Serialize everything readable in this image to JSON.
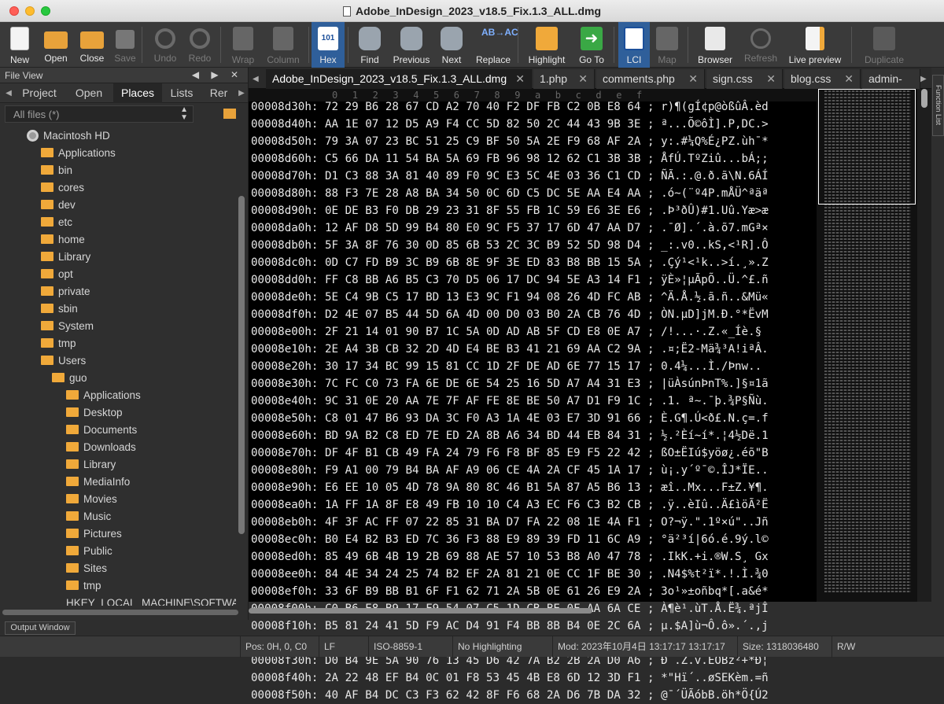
{
  "window": {
    "title": "Adobe_InDesign_2023_v18.5_Fix.1.3_ALL.dmg"
  },
  "toolbar": [
    {
      "id": "new",
      "label": "New",
      "icon": "new-file-icon",
      "enabled": true
    },
    {
      "id": "open",
      "label": "Open",
      "icon": "open-folder-icon",
      "enabled": true
    },
    {
      "id": "close",
      "label": "Close",
      "icon": "close-folder-icon",
      "enabled": true
    },
    {
      "id": "save",
      "label": "Save",
      "icon": "save-icon",
      "enabled": false
    },
    {
      "id": "undo",
      "label": "Undo",
      "icon": "undo-icon",
      "enabled": false
    },
    {
      "id": "redo",
      "label": "Redo",
      "icon": "redo-icon",
      "enabled": false
    },
    {
      "id": "wrap",
      "label": "Wrap",
      "icon": "wrap-icon",
      "enabled": false
    },
    {
      "id": "column",
      "label": "Column",
      "icon": "column-icon",
      "enabled": false
    },
    {
      "id": "hex",
      "label": "Hex",
      "icon": "hex-icon",
      "enabled": true,
      "active": true,
      "icon_text": "101"
    },
    {
      "id": "find",
      "label": "Find",
      "icon": "binoculars-icon",
      "enabled": true
    },
    {
      "id": "previous",
      "label": "Previous",
      "icon": "find-previous-icon",
      "enabled": true
    },
    {
      "id": "next",
      "label": "Next",
      "icon": "find-next-icon",
      "enabled": true
    },
    {
      "id": "replace",
      "label": "Replace",
      "icon": "replace-icon",
      "enabled": true,
      "icon_text": "AB→AC"
    },
    {
      "id": "highlight",
      "label": "Highlight",
      "icon": "highlight-icon",
      "enabled": true
    },
    {
      "id": "goto",
      "label": "Go To",
      "icon": "goto-arrow-icon",
      "enabled": true
    },
    {
      "id": "lci",
      "label": "LCI",
      "icon": "lci-icon",
      "enabled": true,
      "active": true
    },
    {
      "id": "map",
      "label": "Map",
      "icon": "map-icon",
      "enabled": false
    },
    {
      "id": "browser",
      "label": "Browser",
      "icon": "browser-icon",
      "enabled": true
    },
    {
      "id": "refresh",
      "label": "Refresh",
      "icon": "refresh-globe-icon",
      "enabled": false
    },
    {
      "id": "live_preview",
      "label": "Live preview",
      "icon": "live-preview-icon",
      "enabled": true
    },
    {
      "id": "duplicate",
      "label": "Duplicate",
      "icon": "duplicate-icon",
      "enabled": false
    }
  ],
  "file_view": {
    "title": "File View",
    "header_controls": "◀ ▶ ✕",
    "tabs": [
      "Project",
      "Open",
      "Places",
      "Lists",
      "Rer"
    ],
    "active_tab": "Places",
    "filter": "All files (*)",
    "tree": [
      {
        "label": "Macintosh HD",
        "icon": "hard-drive-icon",
        "level": 0
      },
      {
        "label": "Applications",
        "icon": "folder-icon",
        "level": 1
      },
      {
        "label": "bin",
        "icon": "folder-icon",
        "level": 1
      },
      {
        "label": "cores",
        "icon": "folder-icon",
        "level": 1
      },
      {
        "label": "dev",
        "icon": "folder-icon",
        "level": 1
      },
      {
        "label": "etc",
        "icon": "folder-icon",
        "level": 1
      },
      {
        "label": "home",
        "icon": "folder-icon",
        "level": 1
      },
      {
        "label": "Library",
        "icon": "folder-icon",
        "level": 1
      },
      {
        "label": "opt",
        "icon": "folder-icon",
        "level": 1
      },
      {
        "label": "private",
        "icon": "folder-icon",
        "level": 1
      },
      {
        "label": "sbin",
        "icon": "folder-icon",
        "level": 1
      },
      {
        "label": "System",
        "icon": "folder-icon",
        "level": 1
      },
      {
        "label": "tmp",
        "icon": "folder-icon",
        "level": 1
      },
      {
        "label": "Users",
        "icon": "folder-icon",
        "level": 1
      },
      {
        "label": "guo",
        "icon": "folder-icon",
        "level": 2
      },
      {
        "label": "Applications",
        "icon": "folder-icon",
        "level": 3
      },
      {
        "label": "Desktop",
        "icon": "folder-icon",
        "level": 3
      },
      {
        "label": "Documents",
        "icon": "folder-icon",
        "level": 3
      },
      {
        "label": "Downloads",
        "icon": "folder-icon",
        "level": 3
      },
      {
        "label": "Library",
        "icon": "folder-icon",
        "level": 3
      },
      {
        "label": "MediaInfo",
        "icon": "folder-icon",
        "level": 3
      },
      {
        "label": "Movies",
        "icon": "folder-icon",
        "level": 3
      },
      {
        "label": "Music",
        "icon": "folder-icon",
        "level": 3
      },
      {
        "label": "Pictures",
        "icon": "folder-icon",
        "level": 3
      },
      {
        "label": "Public",
        "icon": "folder-icon",
        "level": 3
      },
      {
        "label": "Sites",
        "icon": "folder-icon",
        "level": 3
      },
      {
        "label": "tmp",
        "icon": "folder-icon",
        "level": 3
      },
      {
        "label": "HKEY_LOCAL_MACHINE\\SOFTWA",
        "icon": "none",
        "level": 3
      }
    ],
    "output_window": "Output Window"
  },
  "editor_tabs": [
    {
      "label": "Adobe_InDesign_2023_v18.5_Fix.1.3_ALL.dmg",
      "active": true
    },
    {
      "label": "1.php",
      "active": false
    },
    {
      "label": "comments.php",
      "active": false
    },
    {
      "label": "sign.css",
      "active": false
    },
    {
      "label": "blog.css",
      "active": false
    },
    {
      "label": "admin-zh_",
      "active": false
    }
  ],
  "hex": {
    "ruler": [
      "0",
      "1",
      "2",
      "3",
      "4",
      "5",
      "6",
      "7",
      "8",
      "9",
      "a",
      "b",
      "c",
      "d",
      "e",
      "f"
    ],
    "rows": [
      {
        "addr": "00008d30h:",
        "bytes": "72 29 B6 28 67 CD A2 70 40 F2 DF FB C2 0B E8 64",
        "ascii": "r)¶(gÍ¢p@òßûÂ.èd"
      },
      {
        "addr": "00008d40h:",
        "bytes": "AA 1E 07 12 D5 A9 F4 CC 5D 82 50 2C 44 43 9B 3E",
        "ascii": "ª...Õ©ôÌ].P,DC.>"
      },
      {
        "addr": "00008d50h:",
        "bytes": "79 3A 07 23 BC 51 25 C9 BF 50 5A 2E F9 68 AF 2A",
        "ascii": "y:.#¼Q%É¿PZ.ùh¯*"
      },
      {
        "addr": "00008d60h:",
        "bytes": "C5 66 DA 11 54 BA 5A 69 FB 96 98 12 62 C1 3B 3B",
        "ascii": "ÅfÚ.TºZiû...bÁ;;"
      },
      {
        "addr": "00008d70h:",
        "bytes": "D1 C3 88 3A 81 40 89 F0 9C E3 5C 4E 03 36 C1 CD",
        "ascii": "ÑÃ.:.@.ð.ã\\N.6ÁÍ"
      },
      {
        "addr": "00008d80h:",
        "bytes": "88 F3 7E 28 A8 BA 34 50 0C 6D C5 DC 5E AA E4 AA",
        "ascii": ".ó~(¨º4P.mÅÜ^ªäª"
      },
      {
        "addr": "00008d90h:",
        "bytes": "0E DE B3 F0 DB 29 23 31 8F 55 FB 1C 59 E6 3E E6",
        "ascii": ".Þ³ðÛ)#1.Uû.Yæ>æ"
      },
      {
        "addr": "00008da0h:",
        "bytes": "12 AF D8 5D 99 B4 80 E0 9C F5 37 17 6D 47 AA D7",
        "ascii": ".¯Ø].´.à.õ7.mGª×"
      },
      {
        "addr": "00008db0h:",
        "bytes": "5F 3A 8F 76 30 0D 85 6B 53 2C 3C B9 52 5D 98 D4",
        "ascii": "_:.v0..kS,<¹R].Ô"
      },
      {
        "addr": "00008dc0h:",
        "bytes": "0D C7 FD B9 3C B9 6B 8E 9F 3E ED 83 B8 BB 15 5A",
        "ascii": ".Çý¹<¹k..>í.¸».Z"
      },
      {
        "addr": "00008dd0h:",
        "bytes": "FF C8 BB A6 B5 C3 70 D5 06 17 DC 94 5E A3 14 F1",
        "ascii": "ÿÈ»¦µÃpÕ..Ü.^£.ñ"
      },
      {
        "addr": "00008de0h:",
        "bytes": "5E C4 9B C5 17 BD 13 E3 9C F1 94 08 26 4D FC AB",
        "ascii": "^Ä.Å.½.ã.ñ..&Mü«"
      },
      {
        "addr": "00008df0h:",
        "bytes": "D2 4E 07 B5 44 5D 6A 4D 00 D0 03 B0 2A CB 76 4D",
        "ascii": "ÒN.µD]jM.Ð.°*ËvM"
      },
      {
        "addr": "00008e00h:",
        "bytes": "2F 21 14 01 90 B7 1C 5A 0D AD AB 5F CD E8 0E A7",
        "ascii": "/!...·.Z.­«_Íè.§"
      },
      {
        "addr": "00008e10h:",
        "bytes": "2E A4 3B CB 32 2D 4D E4 BE B3 41 21 69 AA C2 9A",
        "ascii": ".¤;Ë2-Mä¾³A!iªÂ."
      },
      {
        "addr": "00008e20h:",
        "bytes": "30 17 34 BC 99 15 81 CC 1D 2F DE AD 6E 77 15 17",
        "ascii": "0.4¼...Ì./Þ­nw.."
      },
      {
        "addr": "00008e30h:",
        "bytes": "7C FC C0 73 FA 6E DE 6E 54 25 16 5D A7 A4 31 E3",
        "ascii": "|üÀsúnÞnT%.]§¤1ã"
      },
      {
        "addr": "00008e40h:",
        "bytes": "9C 31 0E 20 AA 7E 7F AF FE 8E BE 50 A7 D1 F9 1C",
        "ascii": ".1. ª~.¯þ.¾P§Ñù."
      },
      {
        "addr": "00008e50h:",
        "bytes": "C8 01 47 B6 93 DA 3C F0 A3 1A 4E 03 E7 3D 91 66",
        "ascii": "È.G¶.Ú<ð£.N.ç=.f"
      },
      {
        "addr": "00008e60h:",
        "bytes": "BD 9A B2 C8 ED 7E ED 2A 8B A6 34 BD 44 EB 84 31",
        "ascii": "½.²Èí~í*.¦4½Dë.1"
      },
      {
        "addr": "00008e70h:",
        "bytes": "DF 4F B1 CB 49 FA 24 79 F6 F8 BF 85 E9 F5 22 42",
        "ascii": "ßO±ËIú$yöø¿.éõ\"B"
      },
      {
        "addr": "00008e80h:",
        "bytes": "F9 A1 00 79 B4 BA AF A9 06 CE 4A 2A CF 45 1A 17",
        "ascii": "ù¡.y´º¯©.ÎJ*ÏE.."
      },
      {
        "addr": "00008e90h:",
        "bytes": "E6 EE 10 05 4D 78 9A 80 8C 46 B1 5A 87 A5 B6 13",
        "ascii": "æî..Mx...F±Z.¥¶."
      },
      {
        "addr": "00008ea0h:",
        "bytes": "1A FF 1A 8F E8 49 FB 10 10 C4 A3 EC F6 C3 B2 CB",
        "ascii": ".ÿ..èIû..Ä£ìöÃ²Ë"
      },
      {
        "addr": "00008eb0h:",
        "bytes": "4F 3F AC FF 07 22 85 31 BA D7 FA 22 08 1E 4A F1",
        "ascii": "O?¬ÿ.\".1º×ú\"..Jñ"
      },
      {
        "addr": "00008ec0h:",
        "bytes": "B0 E4 B2 B3 ED 7C 36 F3 88 E9 89 39 FD 11 6C A9",
        "ascii": "°ä²³í|6ó.é.9ý.l©"
      },
      {
        "addr": "00008ed0h:",
        "bytes": "85 49 6B 4B 19 2B 69 88 AE 57 10 53 B8 A0 47 78",
        "ascii": ".IkK.+i.®W.S¸ Gx"
      },
      {
        "addr": "00008ee0h:",
        "bytes": "84 4E 34 24 25 74 B2 EF 2A 81 21 0E CC 1F BE 30",
        "ascii": ".N4$%t²ï*.!.Ì.¾0"
      },
      {
        "addr": "00008ef0h:",
        "bytes": "33 6F B9 BB B1 6F F1 62 71 2A 5B 0E 61 26 E9 2A",
        "ascii": "3o¹»±oñbq*[.a&é*"
      },
      {
        "addr": "00008f00h:",
        "bytes": "C0 B6 E8 B9 17 F9 54 07 C5 1D CB BE 0F AA 6A CE",
        "ascii": "À¶è¹.ùT.Å.Ë¾.ªjÎ"
      },
      {
        "addr": "00008f10h:",
        "bytes": "B5 81 24 41 5D F9 AC D4 91 F4 BB 8B B4 0E 2C 6A",
        "ascii": "µ.$A]ù¬Ô.ô».´.,j"
      },
      {
        "addr": "00008f20h:",
        "bytes": "A3 A9 07 83 45 65 9C F9 D4 A5 CF AD 5D 75 1A EF",
        "ascii": "£©..Ee.ùÔ¥Ï­]u.ï"
      },
      {
        "addr": "00008f30h:",
        "bytes": "D0 B4 9E 5A 90 76 13 45 D6 42 7A B2 2B 2A D0 A6",
        "ascii": "Ð´.Z.v.EÖBz²+*Ð¦"
      },
      {
        "addr": "00008f40h:",
        "bytes": "2A 22 48 EF B4 0C 01 F8 53 45 4B E8 6D 12 3D F1",
        "ascii": "*\"Hï´..øSEKèm.=ñ"
      },
      {
        "addr": "00008f50h:",
        "bytes": "40 AF B4 DC C3 F3 62 42 8F F6 68 2A D6 7B DA 32",
        "ascii": "@¯´ÜÃóbB.öh*Ö{Ú2"
      }
    ]
  },
  "function_list": "Function List",
  "status": {
    "pos": "Pos: 0H, 0, C0",
    "line_ending": "LF",
    "encoding": "ISO-8859-1",
    "highlighting": "No Highlighting",
    "modified": "Mod: 2023年10月4日 13:17:17 13:17:17",
    "size": "Size: 1318036480",
    "rw": "R/W"
  }
}
